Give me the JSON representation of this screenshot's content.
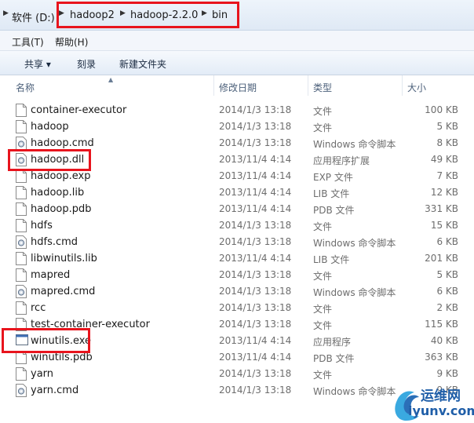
{
  "address_bar": {
    "crumbs": [
      "软件 (D:)",
      "hadoop2",
      "hadoop-2.2.0",
      "bin"
    ]
  },
  "menu": {
    "tools": "工具(T)",
    "help": "帮助(H)"
  },
  "toolbar": {
    "share": "共享 ▾",
    "burn": "刻录",
    "new_folder": "新建文件夹"
  },
  "columns": {
    "name": "名称",
    "date": "修改日期",
    "type": "类型",
    "size": "大小"
  },
  "files": [
    {
      "name": "container-executor",
      "date": "2014/1/3 13:18",
      "type": "文件",
      "size": "100 KB",
      "icon": "blank-file-icon"
    },
    {
      "name": "hadoop",
      "date": "2014/1/3 13:18",
      "type": "文件",
      "size": "5 KB",
      "icon": "blank-file-icon"
    },
    {
      "name": "hadoop.cmd",
      "date": "2014/1/3 13:18",
      "type": "Windows 命令脚本",
      "size": "8 KB",
      "icon": "cmd-script-icon"
    },
    {
      "name": "hadoop.dll",
      "date": "2013/11/4 4:14",
      "type": "应用程序扩展",
      "size": "49 KB",
      "icon": "dll-gear-icon"
    },
    {
      "name": "hadoop.exp",
      "date": "2013/11/4 4:14",
      "type": "EXP 文件",
      "size": "7 KB",
      "icon": "blank-file-icon"
    },
    {
      "name": "hadoop.lib",
      "date": "2013/11/4 4:14",
      "type": "LIB 文件",
      "size": "12 KB",
      "icon": "blank-file-icon"
    },
    {
      "name": "hadoop.pdb",
      "date": "2013/11/4 4:14",
      "type": "PDB 文件",
      "size": "331 KB",
      "icon": "blank-file-icon"
    },
    {
      "name": "hdfs",
      "date": "2014/1/3 13:18",
      "type": "文件",
      "size": "15 KB",
      "icon": "blank-file-icon"
    },
    {
      "name": "hdfs.cmd",
      "date": "2014/1/3 13:18",
      "type": "Windows 命令脚本",
      "size": "6 KB",
      "icon": "cmd-script-icon"
    },
    {
      "name": "libwinutils.lib",
      "date": "2013/11/4 4:14",
      "type": "LIB 文件",
      "size": "201 KB",
      "icon": "blank-file-icon"
    },
    {
      "name": "mapred",
      "date": "2014/1/3 13:18",
      "type": "文件",
      "size": "5 KB",
      "icon": "blank-file-icon"
    },
    {
      "name": "mapred.cmd",
      "date": "2014/1/3 13:18",
      "type": "Windows 命令脚本",
      "size": "6 KB",
      "icon": "cmd-script-icon"
    },
    {
      "name": "rcc",
      "date": "2014/1/3 13:18",
      "type": "文件",
      "size": "2 KB",
      "icon": "blank-file-icon"
    },
    {
      "name": "test-container-executor",
      "date": "2014/1/3 13:18",
      "type": "文件",
      "size": "115 KB",
      "icon": "blank-file-icon"
    },
    {
      "name": "winutils.exe",
      "date": "2013/11/4 4:14",
      "type": "应用程序",
      "size": "40 KB",
      "icon": "exe-window-icon"
    },
    {
      "name": "winutils.pdb",
      "date": "2013/11/4 4:14",
      "type": "PDB 文件",
      "size": "363 KB",
      "icon": "blank-file-icon"
    },
    {
      "name": "yarn",
      "date": "2014/1/3 13:18",
      "type": "文件",
      "size": "9 KB",
      "icon": "blank-file-icon"
    },
    {
      "name": "yarn.cmd",
      "date": "2014/1/3 13:18",
      "type": "Windows 命令脚本",
      "size": "9 KB",
      "icon": "cmd-script-icon"
    }
  ],
  "watermark": {
    "brand": "运维网",
    "url": "iyunv.com"
  },
  "colors": {
    "highlight_box": "#e8141d",
    "watermark": "#1f5ea8"
  }
}
